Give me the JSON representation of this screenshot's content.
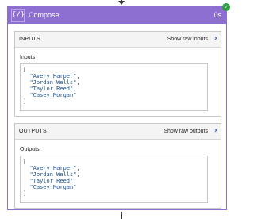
{
  "action": {
    "icon": "curly-braces-icon",
    "icon_glyph": "{/}",
    "title": "Compose",
    "duration": "0s",
    "status_icon": "success-check-icon",
    "status_glyph": "✓"
  },
  "inputs": {
    "header": "INPUTS",
    "raw_link": "Show raw inputs",
    "field_label": "Inputs",
    "open_bracket": "[",
    "items": [
      "\"Avery Harper\",",
      "\"Jordan Wells\",",
      "\"Taylor Reed\",",
      "\"Casey Morgan\""
    ],
    "close_bracket": "]"
  },
  "outputs": {
    "header": "OUTPUTS",
    "raw_link": "Show raw outputs",
    "field_label": "Outputs",
    "open_bracket": "[",
    "items": [
      "\"Avery Harper\",",
      "\"Jordan Wells\",",
      "\"Taylor Reed\",",
      "\"Casey Morgan\""
    ],
    "close_bracket": "]"
  },
  "colors": {
    "accent": "#8c6fd1",
    "success": "#2e9e42",
    "link_chevron": "#2b5fb4",
    "code_text": "#1a4f8b"
  }
}
